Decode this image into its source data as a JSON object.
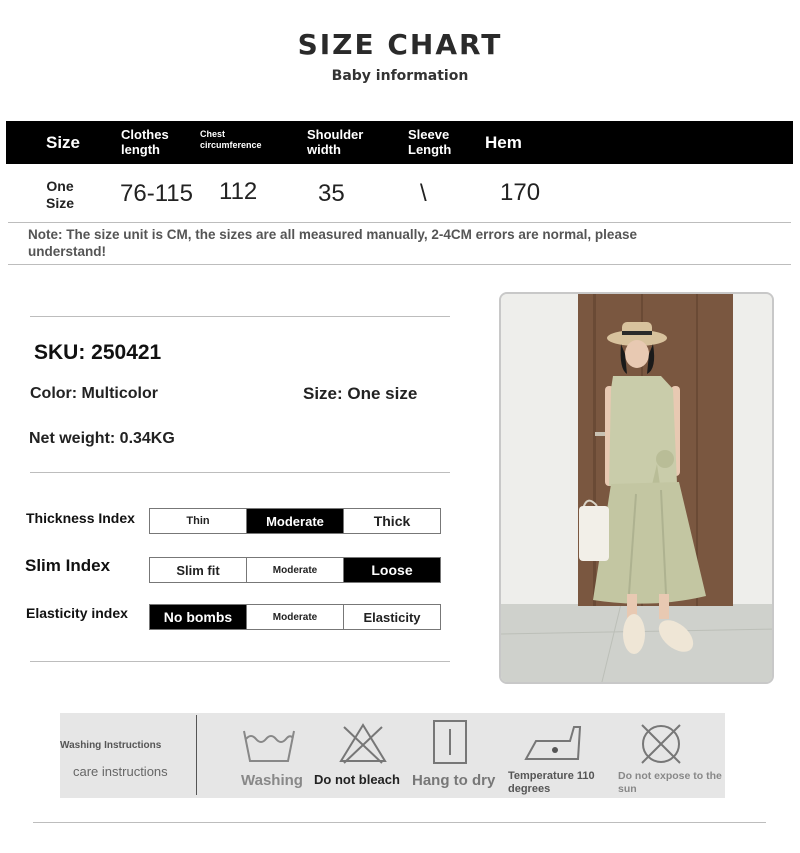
{
  "header": {
    "title": "SIZE CHART",
    "subtitle": "Baby information"
  },
  "size_table": {
    "columns": [
      "Size",
      "Clothes length",
      "Chest circumference",
      "Shoulder width",
      "Sleeve Length",
      "Hem"
    ],
    "row": {
      "size": "One Size",
      "clothes_length": "76-115",
      "chest": "112",
      "shoulder": "35",
      "sleeve": "\\",
      "hem": "170"
    },
    "note": "Note: The size unit is CM, the sizes are all measured manually, 2-4CM errors are normal, please understand!"
  },
  "product": {
    "sku": "SKU: 250421",
    "color": "Color: Multicolor",
    "size": "Size: One size",
    "net_weight": "Net weight: 0.34KG"
  },
  "indices": [
    {
      "label": "Thickness Index",
      "options": [
        "Thin",
        "Moderate",
        "Thick"
      ],
      "selected": 1
    },
    {
      "label": "Slim Index",
      "options": [
        "Slim fit",
        "Moderate",
        "Loose"
      ],
      "selected": 2
    },
    {
      "label": "Elasticity index",
      "options": [
        "No bombs",
        "Moderate",
        "Elasticity"
      ],
      "selected": 0
    }
  ],
  "care": {
    "title": "Washing Instructions",
    "subtitle": "care instructions",
    "items": [
      {
        "icon": "wash-tub-icon",
        "label": "Washing"
      },
      {
        "icon": "no-bleach-icon",
        "label": "Do not bleach"
      },
      {
        "icon": "hang-dry-icon",
        "label": "Hang to dry"
      },
      {
        "icon": "iron-icon",
        "label": "Temperature 110 degrees"
      },
      {
        "icon": "no-sun-icon",
        "label": "Do not expose to the sun"
      }
    ]
  },
  "colors": {
    "header_bg": "#000000",
    "selected_cell": "#000000",
    "care_bg": "#e6e6e6",
    "garment": "#c9ccaa",
    "door": "#7a5740"
  }
}
